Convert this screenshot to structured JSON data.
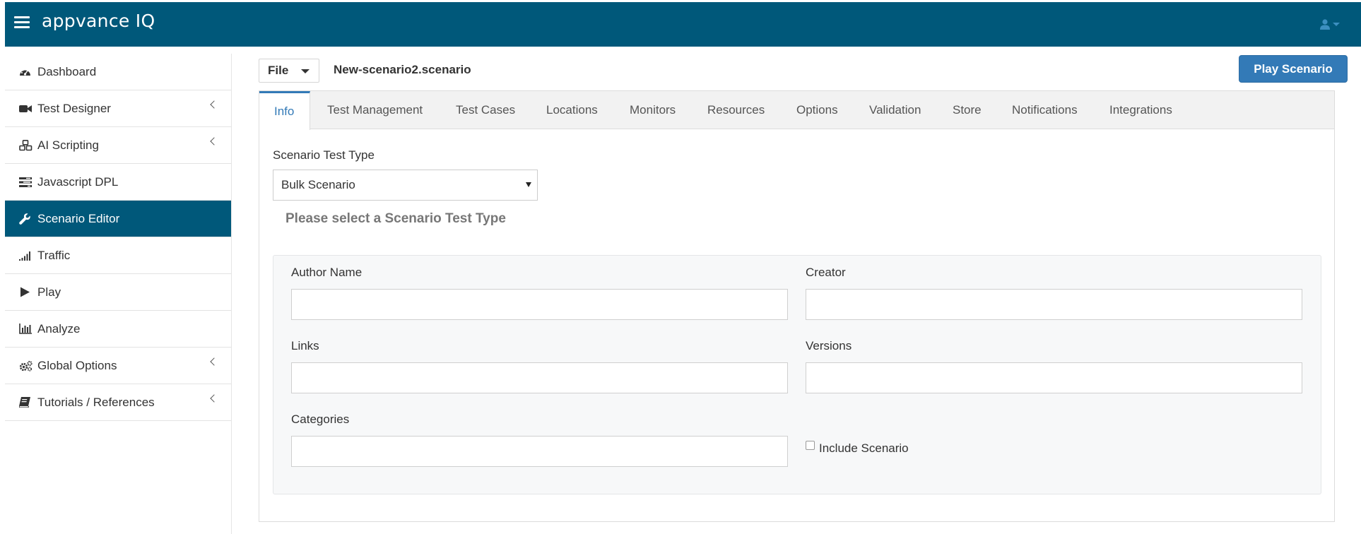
{
  "header": {
    "logo_text": "appvance IQ",
    "menu_icon": "hamburger-menu-icon",
    "user_icon": "user-icon"
  },
  "sidebar": {
    "items": [
      {
        "label": "Dashboard",
        "icon": "dashboard-icon",
        "active": false,
        "has_submenu": false
      },
      {
        "label": "Test Designer",
        "icon": "video-camera-icon",
        "active": false,
        "has_submenu": true
      },
      {
        "label": "AI Scripting",
        "icon": "cubes-icon",
        "active": false,
        "has_submenu": true
      },
      {
        "label": "Javascript DPL",
        "icon": "tasks-icon",
        "active": false,
        "has_submenu": false
      },
      {
        "label": "Scenario Editor",
        "icon": "wrench-icon",
        "active": true,
        "has_submenu": false
      },
      {
        "label": "Traffic",
        "icon": "signal-bars-icon",
        "active": false,
        "has_submenu": false
      },
      {
        "label": "Play",
        "icon": "play-icon",
        "active": false,
        "has_submenu": false
      },
      {
        "label": "Analyze",
        "icon": "bar-chart-icon",
        "active": false,
        "has_submenu": false
      },
      {
        "label": "Global Options",
        "icon": "cogs-icon",
        "active": false,
        "has_submenu": true
      },
      {
        "label": "Tutorials / References",
        "icon": "book-icon",
        "active": false,
        "has_submenu": true
      }
    ]
  },
  "toolbar": {
    "file_label": "File",
    "scenario_name": "New-scenario2.scenario",
    "play_label": "Play Scenario"
  },
  "tabs": [
    {
      "label": "Info",
      "active": true
    },
    {
      "label": "Test Management",
      "active": false
    },
    {
      "label": "Test Cases",
      "active": false
    },
    {
      "label": "Locations",
      "active": false
    },
    {
      "label": "Monitors",
      "active": false
    },
    {
      "label": "Resources",
      "active": false
    },
    {
      "label": "Options",
      "active": false
    },
    {
      "label": "Validation",
      "active": false
    },
    {
      "label": "Store",
      "active": false
    },
    {
      "label": "Notifications",
      "active": false
    },
    {
      "label": "Integrations",
      "active": false
    }
  ],
  "info": {
    "test_type_label": "Scenario Test Type",
    "test_type_value": "Bulk Scenario",
    "hint": "Please select a Scenario Test Type",
    "fields": {
      "author_name": {
        "label": "Author Name",
        "value": ""
      },
      "creator": {
        "label": "Creator",
        "value": ""
      },
      "links": {
        "label": "Links",
        "value": ""
      },
      "versions": {
        "label": "Versions",
        "value": ""
      },
      "categories": {
        "label": "Categories",
        "value": ""
      }
    },
    "include_scenario_label": "Include Scenario",
    "include_scenario_checked": false
  },
  "colors": {
    "header_bg": "#00587a",
    "active_nav_bg": "#00587a",
    "primary_button": "#337ab7",
    "active_tab_text": "#337ab7"
  }
}
